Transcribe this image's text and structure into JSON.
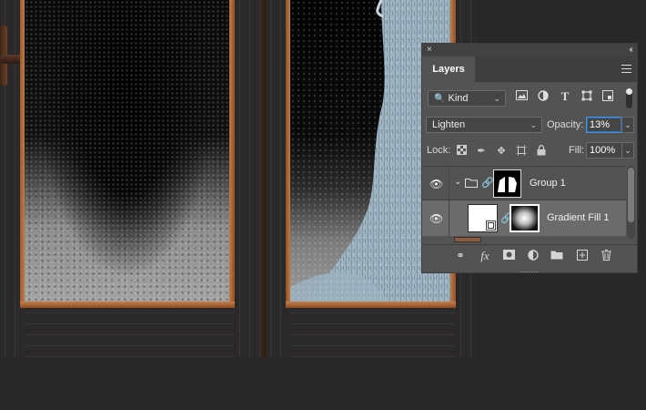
{
  "panel": {
    "close_glyph": "×",
    "collapse_glyph": "‹‹",
    "tab_label": "Layers",
    "filter": {
      "kind_label": "Kind"
    },
    "blend": {
      "mode": "Lighten",
      "opacity_label": "Opacity:",
      "opacity_value": "13%"
    },
    "lock": {
      "label": "Lock:",
      "fill_label": "Fill:",
      "fill_value": "100%"
    },
    "layers": [
      {
        "name": "Group 1",
        "type": "group",
        "visible": true,
        "selected": false
      },
      {
        "name": "Gradient Fill 1",
        "type": "fill",
        "visible": true,
        "selected": true
      }
    ]
  },
  "icons": {
    "close": "close-icon",
    "collapse": "double-chevron-left-icon",
    "menu": "panel-menu-icon",
    "search": "search-icon",
    "pixel_filter": "image-icon",
    "adjustment_filter": "adjustment-icon",
    "type_filter": "type-icon",
    "shape_filter": "shape-icon",
    "smart_filter": "smart-object-icon",
    "eye": "eye-icon",
    "link": "link-icon",
    "fx": "fx-icon",
    "mask": "add-mask-icon",
    "adjustment": "new-adjustment-icon",
    "folder": "new-group-icon",
    "new_layer": "new-layer-icon",
    "trash": "trash-icon"
  },
  "colors": {
    "panel_bg": "#535353",
    "selected_row": "#6b6b6b",
    "accent": "#4a8fd8",
    "canvas_bg": "#282828"
  }
}
